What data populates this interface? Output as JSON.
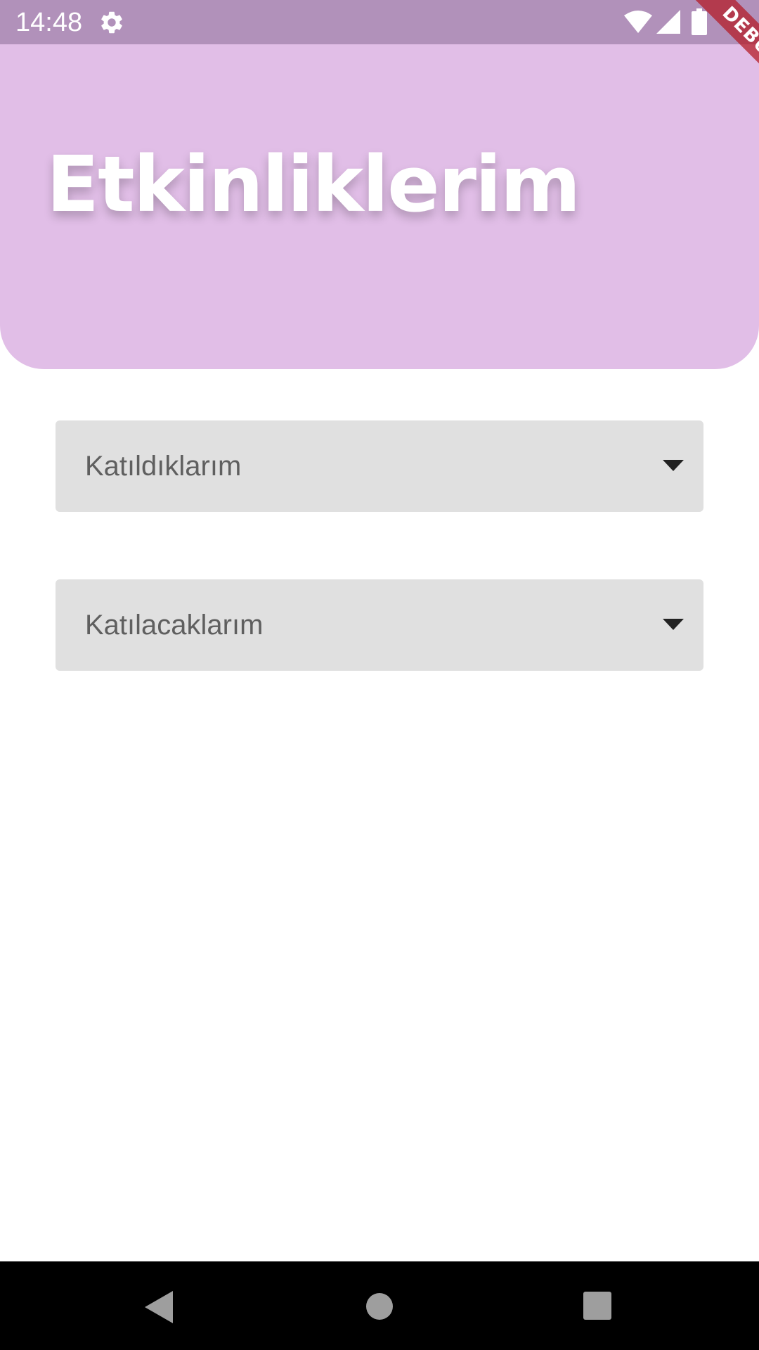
{
  "status_bar": {
    "time": "14:48",
    "icons": [
      "gear-icon",
      "wifi-icon",
      "signal-icon",
      "battery-icon"
    ]
  },
  "debug_banner": "DEBUG",
  "header": {
    "title": "Etkinliklerim",
    "background_color": "#E1BEE7"
  },
  "dropdowns": [
    {
      "label": "Katıldıklarım",
      "icon": "arrow-drop-down-icon"
    },
    {
      "label": "Katılacaklarım",
      "icon": "arrow-drop-down-icon"
    }
  ],
  "nav_bar": {
    "icons": [
      "back-icon",
      "home-icon",
      "recents-icon"
    ]
  }
}
